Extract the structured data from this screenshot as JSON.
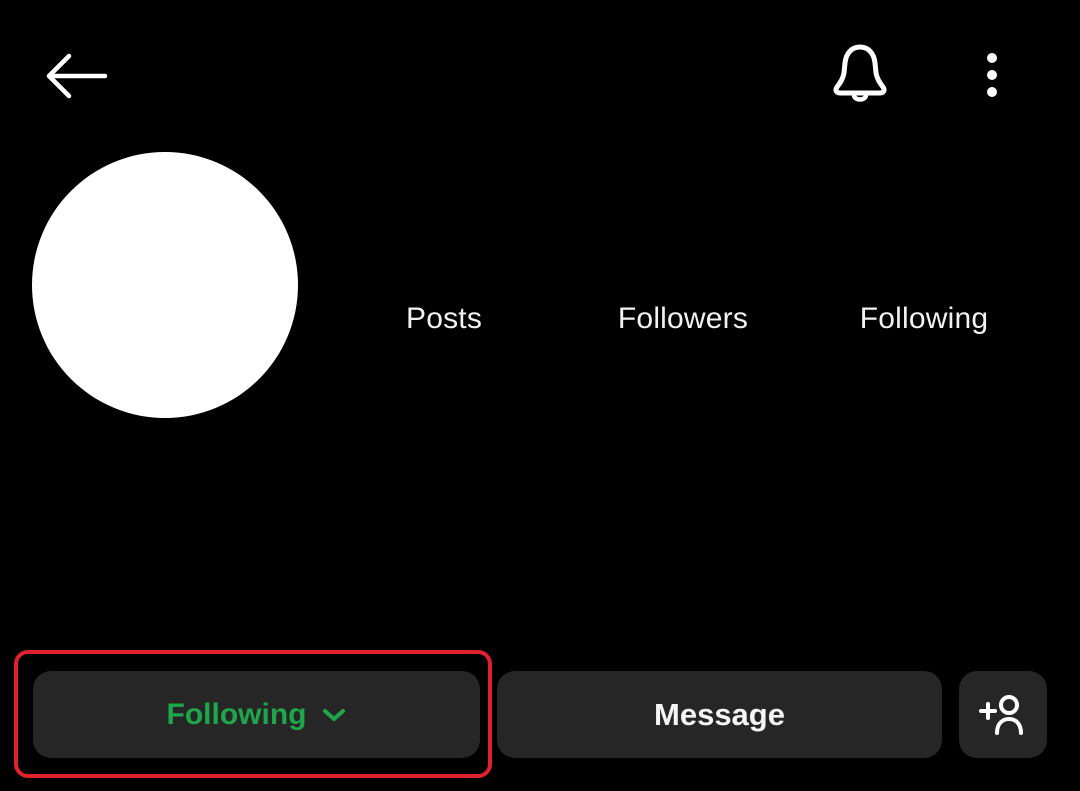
{
  "header": {
    "back_icon": "arrow-left-icon",
    "notifications_icon": "bell-icon",
    "more_icon": "more-vertical-icon"
  },
  "profile": {
    "avatar": "blank-white-avatar",
    "stats": [
      {
        "label": "Posts"
      },
      {
        "label": "Followers"
      },
      {
        "label": "Following"
      }
    ]
  },
  "actions": {
    "following_label": "Following",
    "following_icon": "chevron-down-icon",
    "message_label": "Message",
    "add_user_icon": "add-person-icon"
  },
  "colors": {
    "background": "#000000",
    "button_bg": "#262626",
    "following_accent": "#1fa64a",
    "highlight": "#e0222e"
  }
}
